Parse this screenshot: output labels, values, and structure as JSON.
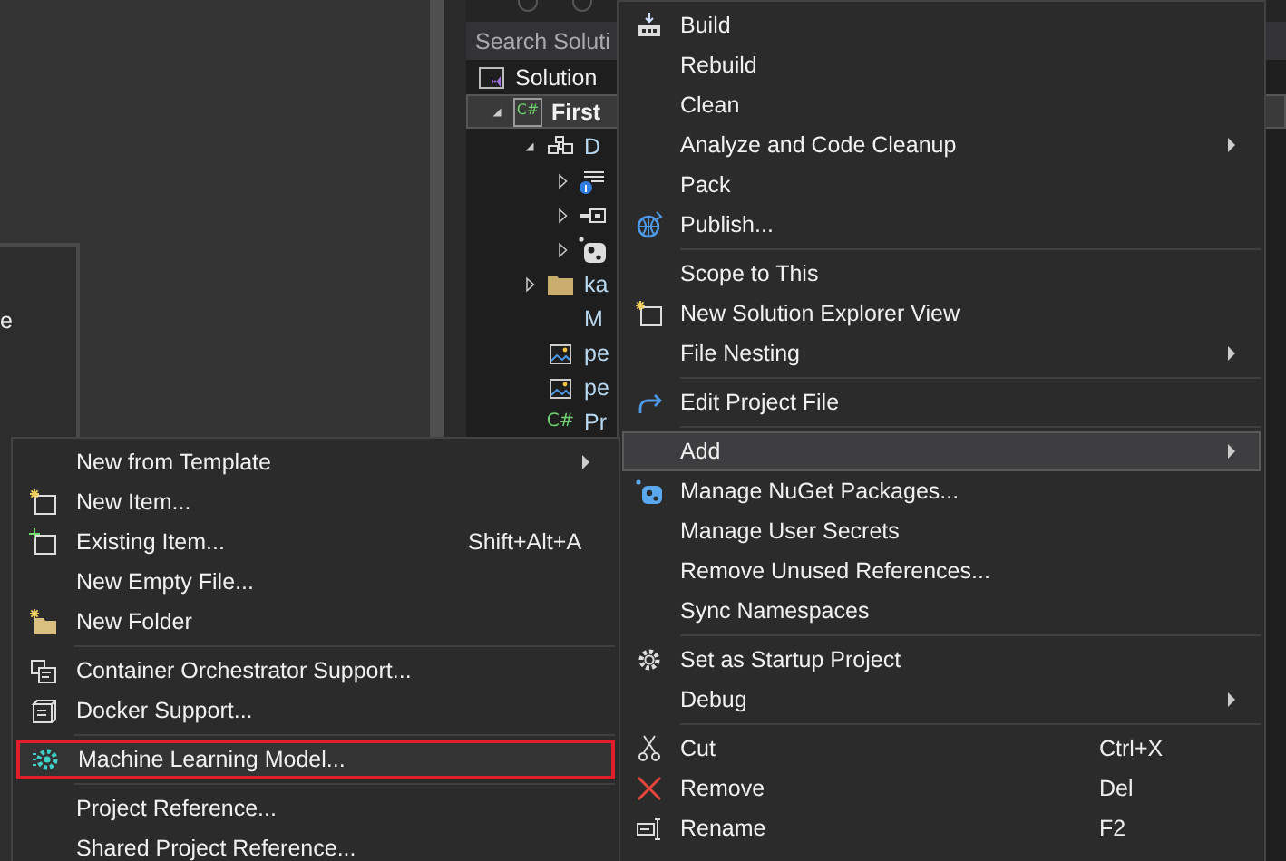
{
  "side_panel": {
    "text": "e"
  },
  "solution_explorer": {
    "search": {
      "placeholder": "Search Soluti"
    },
    "solution": {
      "label": "Solution"
    },
    "tree": [
      {
        "label": "First",
        "kind": "csharp-project",
        "badge": "C#",
        "expanded": true,
        "selected": true,
        "children": [
          {
            "label": "D",
            "kind": "dependencies",
            "expanded": true,
            "selected": false,
            "children": [
              {
                "kind": "info-doc",
                "expanded": false,
                "selected": false
              },
              {
                "kind": "reference",
                "expanded": false,
                "selected": false
              },
              {
                "kind": "package",
                "expanded": false,
                "selected": false
              }
            ]
          },
          {
            "label": "ka",
            "kind": "folder",
            "expanded": false,
            "selected": false
          },
          {
            "label": "M",
            "kind": "plain",
            "selected": false
          },
          {
            "label": "pe",
            "kind": "image",
            "selected": false
          },
          {
            "label": "pe",
            "kind": "image",
            "selected": false
          },
          {
            "label": "Pr",
            "kind": "csharp",
            "badge": "C#",
            "selected": false
          }
        ]
      }
    ]
  },
  "context_menu": {
    "items": [
      {
        "kind": "build",
        "label": "Build",
        "selected": false
      },
      {
        "kind": "plain",
        "label": "Rebuild",
        "selected": false
      },
      {
        "kind": "plain",
        "label": "Clean",
        "selected": false
      },
      {
        "kind": "plain",
        "label": "Analyze and Code Cleanup",
        "submenu": true,
        "selected": false
      },
      {
        "kind": "plain",
        "label": "Pack",
        "selected": false
      },
      {
        "kind": "globe",
        "label": "Publish...",
        "selected": false
      },
      {
        "kind": "separator"
      },
      {
        "kind": "plain",
        "label": "Scope to This",
        "selected": false
      },
      {
        "kind": "new-window",
        "label": "New Solution Explorer View",
        "selected": false
      },
      {
        "kind": "plain",
        "label": "File Nesting",
        "submenu": true,
        "selected": false
      },
      {
        "kind": "separator"
      },
      {
        "kind": "redo",
        "label": "Edit Project File",
        "selected": false
      },
      {
        "kind": "separator"
      },
      {
        "kind": "plain",
        "label": "Add",
        "submenu": true,
        "selected": true
      },
      {
        "kind": "nuget",
        "label": "Manage NuGet Packages...",
        "selected": false
      },
      {
        "kind": "plain",
        "label": "Manage User Secrets",
        "selected": false
      },
      {
        "kind": "plain",
        "label": "Remove Unused References...",
        "selected": false
      },
      {
        "kind": "plain",
        "label": "Sync Namespaces",
        "selected": false
      },
      {
        "kind": "separator"
      },
      {
        "kind": "gear",
        "label": "Set as Startup Project",
        "selected": false
      },
      {
        "kind": "plain",
        "label": "Debug",
        "submenu": true,
        "selected": false
      },
      {
        "kind": "separator"
      },
      {
        "kind": "scissors",
        "label": "Cut",
        "shortcut": "Ctrl+X",
        "selected": false
      },
      {
        "kind": "cross",
        "label": "Remove",
        "shortcut": "Del",
        "selected": false
      },
      {
        "kind": "rename",
        "label": "Rename",
        "shortcut": "F2",
        "selected": false
      }
    ]
  },
  "add_submenu": {
    "items": [
      {
        "kind": "plain",
        "label": "New from Template",
        "submenu": true,
        "selected": false
      },
      {
        "kind": "new-item",
        "label": "New Item...",
        "selected": false
      },
      {
        "kind": "existing-item",
        "label": "Existing Item...",
        "shortcut": "Shift+Alt+A",
        "selected": false
      },
      {
        "kind": "plain",
        "label": "New Empty File...",
        "selected": false
      },
      {
        "kind": "new-folder",
        "label": "New Folder",
        "selected": false
      },
      {
        "kind": "separator"
      },
      {
        "kind": "containers",
        "label": "Container Orchestrator Support...",
        "selected": false
      },
      {
        "kind": "container",
        "label": "Docker Support...",
        "selected": false
      },
      {
        "kind": "separator"
      },
      {
        "kind": "ml",
        "label": "Machine Learning Model...",
        "selected": true
      },
      {
        "kind": "separator"
      },
      {
        "kind": "plain",
        "label": "Project Reference...",
        "selected": false
      },
      {
        "kind": "plain",
        "label": "Shared Project Reference...",
        "selected": false
      }
    ]
  }
}
